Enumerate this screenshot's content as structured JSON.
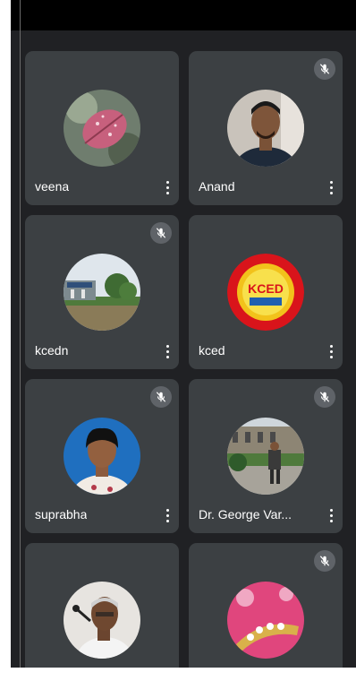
{
  "participants": [
    {
      "name": "veena",
      "muted": false
    },
    {
      "name": "Anand",
      "muted": true
    },
    {
      "name": "kcedn",
      "muted": true
    },
    {
      "name": "kced",
      "muted": false
    },
    {
      "name": "suprabha",
      "muted": true
    },
    {
      "name": "Dr. George Var...",
      "muted": true
    },
    {
      "name": "",
      "muted": false
    },
    {
      "name": "",
      "muted": true
    }
  ],
  "logo_text": "KCED",
  "colors": {
    "background": "#202124",
    "tile": "#3c4043",
    "mute_badge": "#5f6368"
  }
}
